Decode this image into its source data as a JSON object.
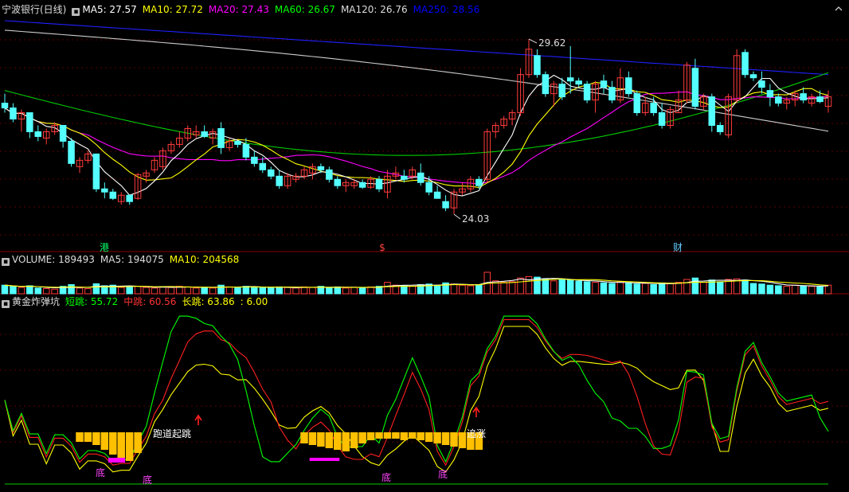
{
  "main_header": {
    "icon": "collapse-square-icon",
    "title": "宁波银行(日线)",
    "ma": [
      {
        "label": "MA5: 27.57",
        "color": "#ffffff"
      },
      {
        "label": "MA10: 27.72",
        "color": "#ffff00"
      },
      {
        "label": "MA20: 27.43",
        "color": "#ff00ff"
      },
      {
        "label": "MA60: 26.67",
        "color": "#00ff00"
      },
      {
        "label": "MA120: 26.76",
        "color": "#dddddd"
      },
      {
        "label": "MA250: 28.56",
        "color": "#0000ff"
      }
    ]
  },
  "volume_header": {
    "icon": "collapse-square-icon",
    "items": [
      {
        "label": "VOLUME: 189493",
        "color": "#dddddd"
      },
      {
        "label": "MA5: 194075",
        "color": "#dddddd"
      },
      {
        "label": "MA10: 204568",
        "color": "#ffff00"
      }
    ]
  },
  "indicator_header": {
    "icon": "collapse-square-icon",
    "items": [
      {
        "label": "黄金炸弹坑",
        "color": "#dddddd"
      },
      {
        "label": "短跳: 55.72",
        "color": "#00ff00"
      },
      {
        "label": "中跳: 60.56",
        "color": "#ff3333"
      },
      {
        "label": "长跳: 63.86",
        "color": "#ffff00"
      },
      {
        "label": ": 6.00",
        "color": "#ffff00"
      }
    ]
  },
  "markers": {
    "hk": "港",
    "dollar": "$",
    "fin": "财",
    "high": "29.62",
    "low": "24.03",
    "di": "底",
    "buy1": "跑道起跳",
    "buy2": "追涨"
  },
  "chart_data": {
    "type": "candlestick",
    "price_range": [
      23.2,
      30.5
    ],
    "candles": [
      [
        27.6,
        27.9,
        27.3,
        27.45
      ],
      [
        27.45,
        27.6,
        27.0,
        27.1
      ],
      [
        27.1,
        27.4,
        26.7,
        27.3
      ],
      [
        27.3,
        27.3,
        26.5,
        26.7
      ],
      [
        26.7,
        26.9,
        26.4,
        26.55
      ],
      [
        26.5,
        26.8,
        26.3,
        26.7
      ],
      [
        26.7,
        27.0,
        26.6,
        26.9
      ],
      [
        26.9,
        26.9,
        26.2,
        26.4
      ],
      [
        26.4,
        26.5,
        25.6,
        25.7
      ],
      [
        25.6,
        25.9,
        25.4,
        25.8
      ],
      [
        25.8,
        26.1,
        25.7,
        26.0
      ],
      [
        26.0,
        26.0,
        24.8,
        24.9
      ],
      [
        24.9,
        25.1,
        24.6,
        24.8
      ],
      [
        24.8,
        24.9,
        24.55,
        24.6
      ],
      [
        24.5,
        24.8,
        24.4,
        24.7
      ],
      [
        24.7,
        24.7,
        24.4,
        24.5
      ],
      [
        24.6,
        25.4,
        24.55,
        25.35
      ],
      [
        25.3,
        25.5,
        25.1,
        25.4
      ],
      [
        25.5,
        25.9,
        25.4,
        25.8
      ],
      [
        25.6,
        26.2,
        25.5,
        26.1
      ],
      [
        26.1,
        26.4,
        26.0,
        26.3
      ],
      [
        26.3,
        26.7,
        26.2,
        26.5
      ],
      [
        26.5,
        26.9,
        26.4,
        26.8
      ],
      [
        26.6,
        26.9,
        26.5,
        26.7
      ],
      [
        26.7,
        26.9,
        26.5,
        26.55
      ],
      [
        26.5,
        26.8,
        26.3,
        26.7
      ],
      [
        26.8,
        27.0,
        26.0,
        26.2
      ],
      [
        26.2,
        26.5,
        26.1,
        26.4
      ],
      [
        26.4,
        26.4,
        26.2,
        26.3
      ],
      [
        26.3,
        26.5,
        25.8,
        25.9
      ],
      [
        25.9,
        26.1,
        25.6,
        25.7
      ],
      [
        25.7,
        25.9,
        25.4,
        25.5
      ],
      [
        25.5,
        25.6,
        25.2,
        25.3
      ],
      [
        25.3,
        25.5,
        24.9,
        25.0
      ],
      [
        25.0,
        25.4,
        24.9,
        25.3
      ],
      [
        25.2,
        25.4,
        25.1,
        25.3
      ],
      [
        25.3,
        25.6,
        25.2,
        25.5
      ],
      [
        25.4,
        25.7,
        25.2,
        25.6
      ],
      [
        25.6,
        25.7,
        25.4,
        25.5
      ],
      [
        25.5,
        25.6,
        25.1,
        25.2
      ],
      [
        25.2,
        25.3,
        24.9,
        25.0
      ],
      [
        25.0,
        25.2,
        24.8,
        25.1
      ],
      [
        25.0,
        25.2,
        24.9,
        25.1
      ],
      [
        25.1,
        25.2,
        24.9,
        24.95
      ],
      [
        24.95,
        25.3,
        24.9,
        25.2
      ],
      [
        25.2,
        25.3,
        24.8,
        24.9
      ],
      [
        24.8,
        25.5,
        24.6,
        25.3
      ],
      [
        25.3,
        25.6,
        25.2,
        25.4
      ],
      [
        25.3,
        25.5,
        25.1,
        25.2
      ],
      [
        25.3,
        25.6,
        25.2,
        25.5
      ],
      [
        25.4,
        25.7,
        25.0,
        25.1
      ],
      [
        25.1,
        25.3,
        24.7,
        24.8
      ],
      [
        24.8,
        25.0,
        24.6,
        24.6
      ],
      [
        24.5,
        24.7,
        24.2,
        24.3
      ],
      [
        24.3,
        24.9,
        24.1,
        24.8
      ],
      [
        24.8,
        25.1,
        24.7,
        24.9
      ],
      [
        24.9,
        25.3,
        24.8,
        25.2
      ],
      [
        25.2,
        25.3,
        24.9,
        25.0
      ],
      [
        25.2,
        26.8,
        25.1,
        26.7
      ],
      [
        26.7,
        27.0,
        26.5,
        26.9
      ],
      [
        26.9,
        27.2,
        26.8,
        27.1
      ],
      [
        27.1,
        27.4,
        26.9,
        27.3
      ],
      [
        27.3,
        28.7,
        27.2,
        28.5
      ],
      [
        28.5,
        29.62,
        28.4,
        29.3
      ],
      [
        29.1,
        29.3,
        28.4,
        28.5
      ],
      [
        28.5,
        28.6,
        27.8,
        27.9
      ],
      [
        27.9,
        28.3,
        27.5,
        28.2
      ],
      [
        28.2,
        28.4,
        27.7,
        27.8
      ],
      [
        28.4,
        29.4,
        27.9,
        28.3
      ],
      [
        28.3,
        28.4,
        28.1,
        28.2
      ],
      [
        28.2,
        28.3,
        27.6,
        27.7
      ],
      [
        27.7,
        28.3,
        27.3,
        28.2
      ],
      [
        28.3,
        28.5,
        27.9,
        28.1
      ],
      [
        28.1,
        28.3,
        27.6,
        27.7
      ],
      [
        27.7,
        28.7,
        27.6,
        28.4
      ],
      [
        28.4,
        28.6,
        27.8,
        27.9
      ],
      [
        27.9,
        28.0,
        27.2,
        27.3
      ],
      [
        27.3,
        27.8,
        27.2,
        27.6
      ],
      [
        27.6,
        27.8,
        27.2,
        27.3
      ],
      [
        27.3,
        27.6,
        26.8,
        26.9
      ],
      [
        26.9,
        27.5,
        26.8,
        27.4
      ],
      [
        27.3,
        28.0,
        27.3,
        27.7
      ],
      [
        27.7,
        28.9,
        27.6,
        28.8
      ],
      [
        28.7,
        29.0,
        27.4,
        27.5
      ],
      [
        27.5,
        27.9,
        27.4,
        27.8
      ],
      [
        27.8,
        27.9,
        26.7,
        26.9
      ],
      [
        26.9,
        27.0,
        26.6,
        26.7
      ],
      [
        26.6,
        27.9,
        26.5,
        27.8
      ],
      [
        27.7,
        29.3,
        27.6,
        29.1
      ],
      [
        29.2,
        29.3,
        28.4,
        28.5
      ],
      [
        28.5,
        28.6,
        28.3,
        28.4
      ],
      [
        28.3,
        28.6,
        27.9,
        28.1
      ],
      [
        28.0,
        28.2,
        27.5,
        27.8
      ],
      [
        27.8,
        27.9,
        27.5,
        27.6
      ],
      [
        27.6,
        27.8,
        27.4,
        27.7
      ],
      [
        27.7,
        28.0,
        27.5,
        27.9
      ],
      [
        27.9,
        28.1,
        27.6,
        27.7
      ],
      [
        27.6,
        27.9,
        27.5,
        27.8
      ],
      [
        27.8,
        28.0,
        27.6,
        27.65
      ],
      [
        27.5,
        28.0,
        27.3,
        27.8
      ]
    ],
    "volumes": [
      0.3,
      0.25,
      0.22,
      0.28,
      0.2,
      0.18,
      0.16,
      0.26,
      0.32,
      0.2,
      0.18,
      0.35,
      0.28,
      0.3,
      0.22,
      0.24,
      0.26,
      0.22,
      0.2,
      0.24,
      0.22,
      0.26,
      0.24,
      0.2,
      0.22,
      0.2,
      0.3,
      0.24,
      0.22,
      0.26,
      0.24,
      0.22,
      0.2,
      0.24,
      0.22,
      0.2,
      0.24,
      0.22,
      0.26,
      0.22,
      0.24,
      0.2,
      0.22,
      0.22,
      0.24,
      0.26,
      0.4,
      0.3,
      0.28,
      0.26,
      0.32,
      0.34,
      0.3,
      0.38,
      0.34,
      0.3,
      0.28,
      0.3,
      0.75,
      0.45,
      0.4,
      0.42,
      0.55,
      0.6,
      0.58,
      0.5,
      0.45,
      0.5,
      0.48,
      0.44,
      0.42,
      0.4,
      0.38,
      0.36,
      0.42,
      0.38,
      0.34,
      0.36,
      0.32,
      0.38,
      0.36,
      0.4,
      0.5,
      0.55,
      0.4,
      0.48,
      0.42,
      0.5,
      0.52,
      0.48,
      0.36,
      0.34,
      0.3,
      0.28,
      0.26,
      0.3,
      0.28,
      0.26,
      0.24,
      0.3
    ]
  }
}
